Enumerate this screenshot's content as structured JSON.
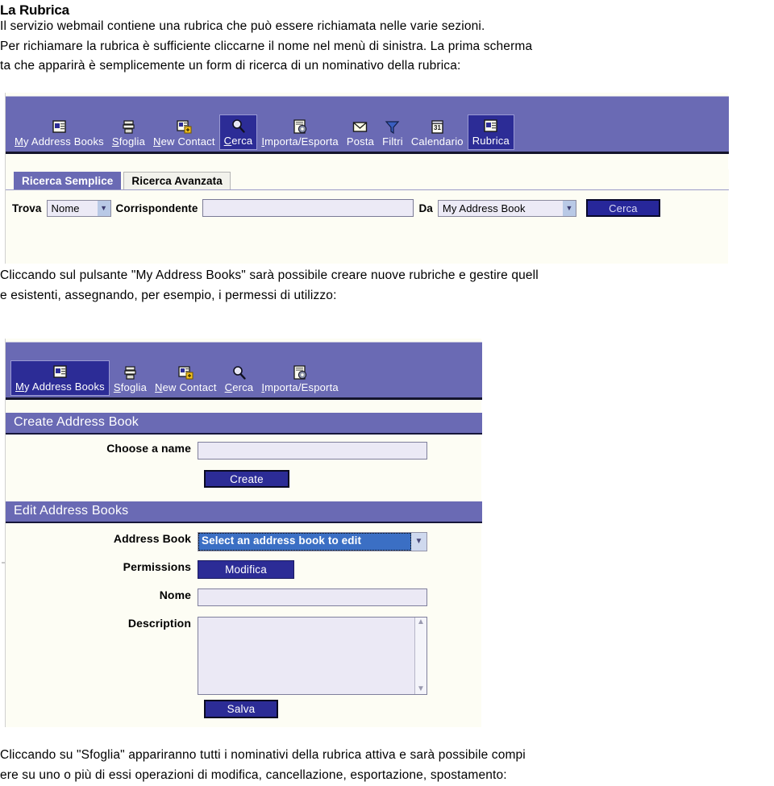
{
  "document": {
    "title": "La Rubrica",
    "intro_paragraph": "Il servizio webmail contiene una rubrica che può essere richiamata nelle varie sezioni.\nPer richiamare la rubrica è sufficiente cliccarne il nome nel menù di sinistra. La prima scherma\nta che apparirà è semplicemente un form di ricerca di un nominativo della rubrica:",
    "middle_paragraph": "Cliccando sul pulsante \"My Address Books\" sarà possibile creare nuove rubriche e gestire quell\ne esistenti, assegnando, per esempio, i permessi di utilizzo:",
    "closing_paragraph": "Cliccando su \"Sfoglia\" appariranno tutti i nominativi della rubrica attiva e sarà possibile compi\nere su uno o più di essi operazioni di modifica, cancellazione, esportazione, spostamento:"
  },
  "colors": {
    "toolbar_bg": "#6a6ab4",
    "toolbar_selected": "#2c2c96",
    "button_navy": "#27279a",
    "field_bg": "#eceaf6",
    "page_bg": "#fdfdf4",
    "select_highlight": "#3b6fc4"
  },
  "screenshot_search": {
    "toolbar": {
      "items": [
        {
          "label": "My Address Books",
          "underline": "M",
          "icon": "address-book-icon",
          "selected": false
        },
        {
          "label": "Sfoglia",
          "underline": "S",
          "icon": "browse-stack-icon",
          "selected": false
        },
        {
          "label": "New Contact",
          "underline": "N",
          "icon": "new-contact-icon",
          "selected": false
        },
        {
          "label": "Cerca",
          "underline": "C",
          "icon": "magnifier-icon",
          "selected": true
        },
        {
          "label": "Importa/Esporta",
          "underline": "I",
          "icon": "import-export-icon",
          "selected": false
        },
        {
          "label": "Posta",
          "underline": "",
          "icon": "envelope-icon",
          "selected": false
        },
        {
          "label": "Filtri",
          "underline": "",
          "icon": "funnel-icon",
          "selected": false
        },
        {
          "label": "Calendario",
          "underline": "",
          "icon": "calendar-icon",
          "selected": false
        },
        {
          "label": "Rubrica",
          "underline": "",
          "icon": "address-book-icon",
          "selected": true
        }
      ]
    },
    "tabs": [
      {
        "label": "Ricerca Semplice",
        "active": true
      },
      {
        "label": "Ricerca Avanzata",
        "active": false
      }
    ],
    "form": {
      "find_label": "Trova",
      "field_select_value": "Nome",
      "match_label": "Corrispondente",
      "query_value": "",
      "from_label": "Da",
      "book_select_value": "My Address Book",
      "search_button": "Cerca"
    }
  },
  "screenshot_books": {
    "toolbar": {
      "items": [
        {
          "label": "My Address Books",
          "underline": "M",
          "icon": "address-book-icon",
          "selected": true
        },
        {
          "label": "Sfoglia",
          "underline": "S",
          "icon": "browse-stack-icon",
          "selected": false
        },
        {
          "label": "New Contact",
          "underline": "N",
          "icon": "new-contact-icon",
          "selected": false
        },
        {
          "label": "Cerca",
          "underline": "C",
          "icon": "magnifier-icon",
          "selected": false
        },
        {
          "label": "Importa/Esporta",
          "underline": "I",
          "icon": "import-export-icon",
          "selected": false
        }
      ]
    },
    "create_section": {
      "header": "Create Address Book",
      "name_label": "Choose a name",
      "name_value": "",
      "create_button": "Create"
    },
    "edit_section": {
      "header": "Edit Address Books",
      "book_label": "Address Book",
      "book_select_value": "Select an address book to edit",
      "permissions_label": "Permissions",
      "permissions_button": "Modifica",
      "name_label": "Nome",
      "name_value": "",
      "description_label": "Description",
      "description_value": "",
      "save_button": "Salva"
    }
  }
}
